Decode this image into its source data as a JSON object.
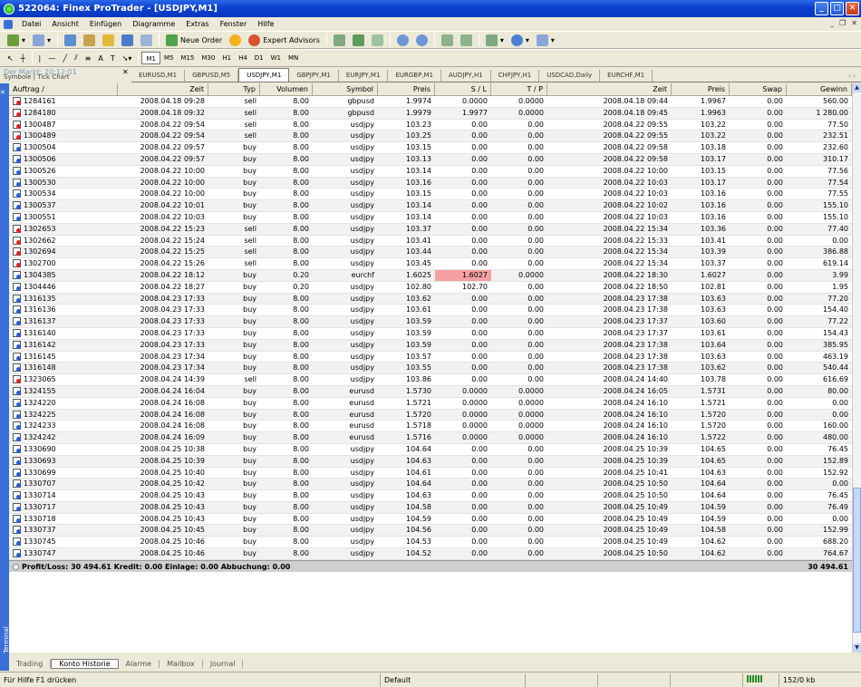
{
  "window": {
    "title": "522064: Finex ProTrader - [USDJPY,M1]"
  },
  "menu": [
    "Datei",
    "Ansicht",
    "Einfügen",
    "Diagramme",
    "Extras",
    "Fenster",
    "Hilfe"
  ],
  "toolbar": {
    "new_order": "Neue Order",
    "expert_advisors": "Expert Advisors"
  },
  "timeframes": [
    "M1",
    "M5",
    "M15",
    "M30",
    "H1",
    "H4",
    "D1",
    "W1",
    "MN"
  ],
  "active_timeframe": "M1",
  "nav": {
    "title": "Der Markt: 20:12:01",
    "tabs": "Symbole | Tick Chart"
  },
  "chart_tabs": [
    "EURUSD,M1",
    "GBPUSD,M5",
    "USDJPY,M1",
    "GBPJPY,M1",
    "EURJPY,M1",
    "EURGBP,M1",
    "AUDJPY,H1",
    "CHFJPY,H1",
    "USDCAD,Daily",
    "EURCHF,M1"
  ],
  "active_chart_tab": "USDJPY,M1",
  "columns": [
    "Auftrag",
    "Zeit",
    "Typ",
    "Volumen",
    "Symbol",
    "Preis",
    "S / L",
    "T / P",
    "Zeit",
    "Preis",
    "Swap",
    "Gewinn"
  ],
  "rows": [
    [
      "1284161",
      "2008.04.18 09:28",
      "sell",
      "8.00",
      "gbpusd",
      "1.9974",
      "0.0000",
      "0.0000",
      "2008.04.18 09:44",
      "1.9967",
      "0.00",
      "560.00"
    ],
    [
      "1284180",
      "2008.04.18 09:32",
      "sell",
      "8.00",
      "gbpusd",
      "1.9979",
      "1.9977",
      "0.0000",
      "2008.04.18 09:45",
      "1.9963",
      "0.00",
      "1 280.00"
    ],
    [
      "1300487",
      "2008.04.22 09:54",
      "sell",
      "8.00",
      "usdjpy",
      "103.23",
      "0.00",
      "0.00",
      "2008.04.22 09:55",
      "103.22",
      "0.00",
      "77.50"
    ],
    [
      "1300489",
      "2008.04.22 09:54",
      "sell",
      "8.00",
      "usdjpy",
      "103.25",
      "0.00",
      "0.00",
      "2008.04.22 09:55",
      "103.22",
      "0.00",
      "232.51"
    ],
    [
      "1300504",
      "2008.04.22 09:57",
      "buy",
      "8.00",
      "usdjpy",
      "103.15",
      "0.00",
      "0.00",
      "2008.04.22 09:58",
      "103.18",
      "0.00",
      "232.60"
    ],
    [
      "1300506",
      "2008.04.22 09:57",
      "buy",
      "8.00",
      "usdjpy",
      "103.13",
      "0.00",
      "0.00",
      "2008.04.22 09:58",
      "103.17",
      "0.00",
      "310.17"
    ],
    [
      "1300526",
      "2008.04.22 10:00",
      "buy",
      "8.00",
      "usdjpy",
      "103.14",
      "0.00",
      "0.00",
      "2008.04.22 10:00",
      "103.15",
      "0.00",
      "77.56"
    ],
    [
      "1300530",
      "2008.04.22 10:00",
      "buy",
      "8.00",
      "usdjpy",
      "103.16",
      "0.00",
      "0.00",
      "2008.04.22 10:03",
      "103.17",
      "0.00",
      "77.54"
    ],
    [
      "1300534",
      "2008.04.22 10:00",
      "buy",
      "8.00",
      "usdjpy",
      "103.15",
      "0.00",
      "0.00",
      "2008.04.22 10:03",
      "103.16",
      "0.00",
      "77.55"
    ],
    [
      "1300537",
      "2008.04.22 10:01",
      "buy",
      "8.00",
      "usdjpy",
      "103.14",
      "0.00",
      "0.00",
      "2008.04.22 10:02",
      "103.16",
      "0.00",
      "155.10"
    ],
    [
      "1300551",
      "2008.04.22 10:03",
      "buy",
      "8.00",
      "usdjpy",
      "103.14",
      "0.00",
      "0.00",
      "2008.04.22 10:03",
      "103.16",
      "0.00",
      "155.10"
    ],
    [
      "1302653",
      "2008.04.22 15:23",
      "sell",
      "8.00",
      "usdjpy",
      "103.37",
      "0.00",
      "0.00",
      "2008.04.22 15:34",
      "103.36",
      "0.00",
      "77.40"
    ],
    [
      "1302662",
      "2008.04.22 15:24",
      "sell",
      "8.00",
      "usdjpy",
      "103.41",
      "0.00",
      "0.00",
      "2008.04.22 15:33",
      "103.41",
      "0.00",
      "0.00"
    ],
    [
      "1302694",
      "2008.04.22 15:25",
      "sell",
      "8.00",
      "usdjpy",
      "103.44",
      "0.00",
      "0.00",
      "2008.04.22 15:34",
      "103.39",
      "0.00",
      "386.88"
    ],
    [
      "1302700",
      "2008.04.22 15:26",
      "sell",
      "8.00",
      "usdjpy",
      "103.45",
      "0.00",
      "0.00",
      "2008.04.22 15:34",
      "103.37",
      "0.00",
      "619.14"
    ],
    [
      "1304385",
      "2008.04.22 18:12",
      "buy",
      "0.20",
      "eurchf",
      "1.6025",
      "1.6027",
      "0.0000",
      "2008.04.22 18:30",
      "1.6027",
      "0.00",
      "3.99"
    ],
    [
      "1304446",
      "2008.04.22 18:27",
      "buy",
      "0.20",
      "usdjpy",
      "102.80",
      "102.70",
      "0.00",
      "2008.04.22 18:50",
      "102.81",
      "0.00",
      "1.95"
    ],
    [
      "1316135",
      "2008.04.23 17:33",
      "buy",
      "8.00",
      "usdjpy",
      "103.62",
      "0.00",
      "0.00",
      "2008.04.23 17:38",
      "103.63",
      "0.00",
      "77.20"
    ],
    [
      "1316136",
      "2008.04.23 17:33",
      "buy",
      "8.00",
      "usdjpy",
      "103.61",
      "0.00",
      "0.00",
      "2008.04.23 17:38",
      "103.63",
      "0.00",
      "154.40"
    ],
    [
      "1316137",
      "2008.04.23 17:33",
      "buy",
      "8.00",
      "usdjpy",
      "103.59",
      "0.00",
      "0.00",
      "2008.04.23 17:37",
      "103.60",
      "0.00",
      "77.22"
    ],
    [
      "1316140",
      "2008.04.23 17:33",
      "buy",
      "8.00",
      "usdjpy",
      "103.59",
      "0.00",
      "0.00",
      "2008.04.23 17:37",
      "103.61",
      "0.00",
      "154.43"
    ],
    [
      "1316142",
      "2008.04.23 17:33",
      "buy",
      "8.00",
      "usdjpy",
      "103.59",
      "0.00",
      "0.00",
      "2008.04.23 17:38",
      "103.64",
      "0.00",
      "385.95"
    ],
    [
      "1316145",
      "2008.04.23 17:34",
      "buy",
      "8.00",
      "usdjpy",
      "103.57",
      "0.00",
      "0.00",
      "2008.04.23 17:38",
      "103.63",
      "0.00",
      "463.19"
    ],
    [
      "1316148",
      "2008.04.23 17:34",
      "buy",
      "8.00",
      "usdjpy",
      "103.55",
      "0.00",
      "0.00",
      "2008.04.23 17:38",
      "103.62",
      "0.00",
      "540.44"
    ],
    [
      "1323065",
      "2008.04.24 14:39",
      "sell",
      "8.00",
      "usdjpy",
      "103.86",
      "0.00",
      "0.00",
      "2008.04.24 14:40",
      "103.78",
      "0.00",
      "616.69"
    ],
    [
      "1324155",
      "2008.04.24 16:04",
      "buy",
      "8.00",
      "eurusd",
      "1.5730",
      "0.0000",
      "0.0000",
      "2008.04.24 16:05",
      "1.5731",
      "0.00",
      "80.00"
    ],
    [
      "1324220",
      "2008.04.24 16:08",
      "buy",
      "8.00",
      "eurusd",
      "1.5721",
      "0.0000",
      "0.0000",
      "2008.04.24 16:10",
      "1.5721",
      "0.00",
      "0.00"
    ],
    [
      "1324225",
      "2008.04.24 16:08",
      "buy",
      "8.00",
      "eurusd",
      "1.5720",
      "0.0000",
      "0.0000",
      "2008.04.24 16:10",
      "1.5720",
      "0.00",
      "0.00"
    ],
    [
      "1324233",
      "2008.04.24 16:08",
      "buy",
      "8.00",
      "eurusd",
      "1.5718",
      "0.0000",
      "0.0000",
      "2008.04.24 16:10",
      "1.5720",
      "0.00",
      "160.00"
    ],
    [
      "1324242",
      "2008.04.24 16:09",
      "buy",
      "8.00",
      "eurusd",
      "1.5716",
      "0.0000",
      "0.0000",
      "2008.04.24 16:10",
      "1.5722",
      "0.00",
      "480.00"
    ],
    [
      "1330690",
      "2008.04.25 10:38",
      "buy",
      "8.00",
      "usdjpy",
      "104.64",
      "0.00",
      "0.00",
      "2008.04.25 10:39",
      "104.65",
      "0.00",
      "76.45"
    ],
    [
      "1330693",
      "2008.04.25 10:39",
      "buy",
      "8.00",
      "usdjpy",
      "104.63",
      "0.00",
      "0.00",
      "2008.04.25 10:39",
      "104.65",
      "0.00",
      "152.89"
    ],
    [
      "1330699",
      "2008.04.25 10:40",
      "buy",
      "8.00",
      "usdjpy",
      "104.61",
      "0.00",
      "0.00",
      "2008.04.25 10:41",
      "104.63",
      "0.00",
      "152.92"
    ],
    [
      "1330707",
      "2008.04.25 10:42",
      "buy",
      "8.00",
      "usdjpy",
      "104.64",
      "0.00",
      "0.00",
      "2008.04.25 10:50",
      "104.64",
      "0.00",
      "0.00"
    ],
    [
      "1330714",
      "2008.04.25 10:43",
      "buy",
      "8.00",
      "usdjpy",
      "104.63",
      "0.00",
      "0.00",
      "2008.04.25 10:50",
      "104.64",
      "0.00",
      "76.45"
    ],
    [
      "1330717",
      "2008.04.25 10:43",
      "buy",
      "8.00",
      "usdjpy",
      "104.58",
      "0.00",
      "0.00",
      "2008.04.25 10:49",
      "104.59",
      "0.00",
      "76.49"
    ],
    [
      "1330718",
      "2008.04.25 10:43",
      "buy",
      "8.00",
      "usdjpy",
      "104.59",
      "0.00",
      "0.00",
      "2008.04.25 10:49",
      "104.59",
      "0.00",
      "0.00"
    ],
    [
      "1330737",
      "2008.04.25 10:45",
      "buy",
      "8.00",
      "usdjpy",
      "104.56",
      "0.00",
      "0.00",
      "2008.04.25 10:49",
      "104.58",
      "0.00",
      "152.99"
    ],
    [
      "1330745",
      "2008.04.25 10:46",
      "buy",
      "8.00",
      "usdjpy",
      "104.53",
      "0.00",
      "0.00",
      "2008.04.25 10:49",
      "104.62",
      "0.00",
      "688.20"
    ],
    [
      "1330747",
      "2008.04.25 10:46",
      "buy",
      "8.00",
      "usdjpy",
      "104.52",
      "0.00",
      "0.00",
      "2008.04.25 10:50",
      "104.62",
      "0.00",
      "764.67"
    ]
  ],
  "highlighted_cell": {
    "order": "1304385",
    "column": "S / L",
    "color": "#f4a0a0"
  },
  "summary": {
    "text": "Profit/Loss: 30 494.61  Kredit: 0.00  Einlage: 0.00  Abbuchung: 0.00",
    "total": "30 494.61"
  },
  "terminal_label": "Terminal",
  "bottom_tabs": [
    "Trading",
    "Konto Historie",
    "Alarme",
    "Mailbox",
    "Journal"
  ],
  "active_bottom_tab": "Konto Historie",
  "status": {
    "help": "Für Hilfe F1 drücken",
    "profile": "Default",
    "traffic": "152/0 kb"
  },
  "colors": {
    "title_bar": "#0a3fcf",
    "sell_marker": "#d22222",
    "buy_marker": "#2a5bd7"
  }
}
